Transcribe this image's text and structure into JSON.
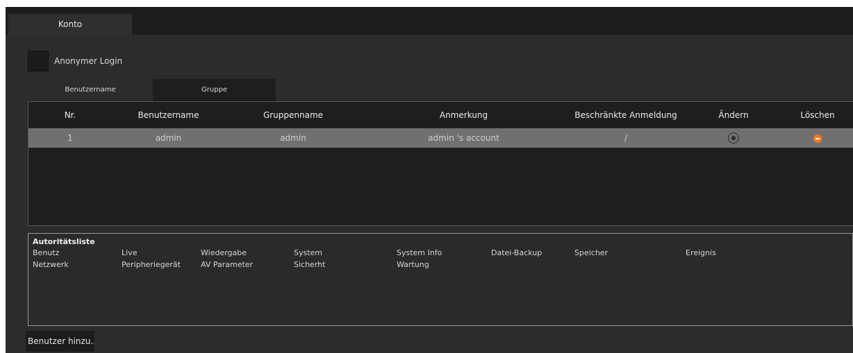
{
  "top_tab": {
    "label": "Konto"
  },
  "anonymous_login": {
    "label": "Anonymer Login",
    "checked": false
  },
  "subtabs": [
    {
      "label": "Benutzername",
      "active": true
    },
    {
      "label": "Gruppe",
      "active": false
    }
  ],
  "user_table": {
    "columns": [
      "Nr.",
      "Benutzername",
      "Gruppenname",
      "Anmerkung",
      "Beschränkte Anmeldung",
      "Ändern",
      "Löschen"
    ],
    "rows": [
      {
        "nr": "1",
        "username": "admin",
        "group": "admin",
        "note": "admin 's account",
        "restricted": "/",
        "edit_icon": "edit-circle-icon",
        "delete_icon": "delete-minus-icon"
      }
    ]
  },
  "authority_list": {
    "title": "Autoritätsliste",
    "items_row1": [
      "Benutz",
      "Live",
      "Wiedergabe",
      "System",
      "System Info",
      "Datei-Backup",
      "Speicher",
      "Ereignis"
    ],
    "items_row2": [
      "Netzwerk",
      "Peripheriegerät",
      "AV Parameter",
      "Sicherht",
      "Wartung"
    ]
  },
  "add_user_button": {
    "label": "Benutzer hinzu..."
  },
  "colors": {
    "background": "#2a2a2a",
    "selected_row": "#707070",
    "delete_accent": "#ff7a1a"
  }
}
